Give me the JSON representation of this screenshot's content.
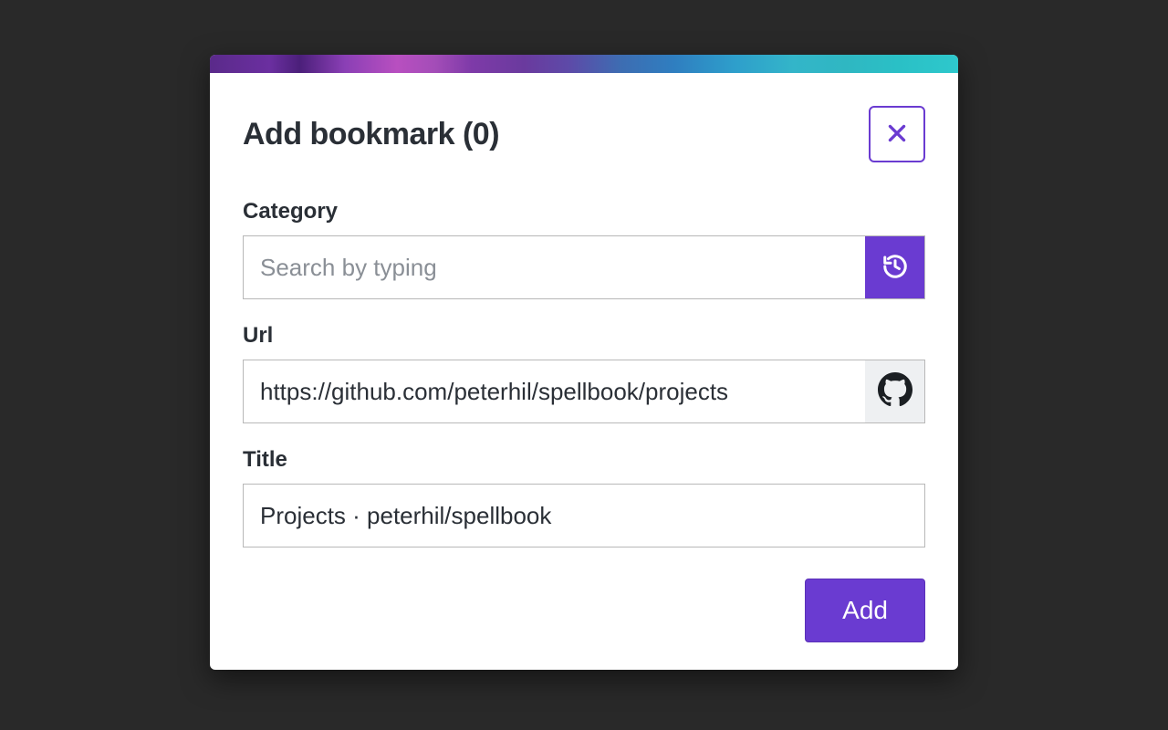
{
  "modal": {
    "title": "Add bookmark (0)",
    "fields": {
      "category": {
        "label": "Category",
        "placeholder": "Search by typing",
        "value": ""
      },
      "url": {
        "label": "Url",
        "value": "https://github.com/peterhil/spellbook/projects"
      },
      "title": {
        "label": "Title",
        "value": "Projects · peterhil/spellbook"
      }
    },
    "buttons": {
      "add": "Add"
    }
  },
  "icons": {
    "close": "close-icon",
    "history": "history-icon",
    "github": "github-icon"
  },
  "colors": {
    "accent": "#6a3bd1",
    "background": "#292929"
  }
}
